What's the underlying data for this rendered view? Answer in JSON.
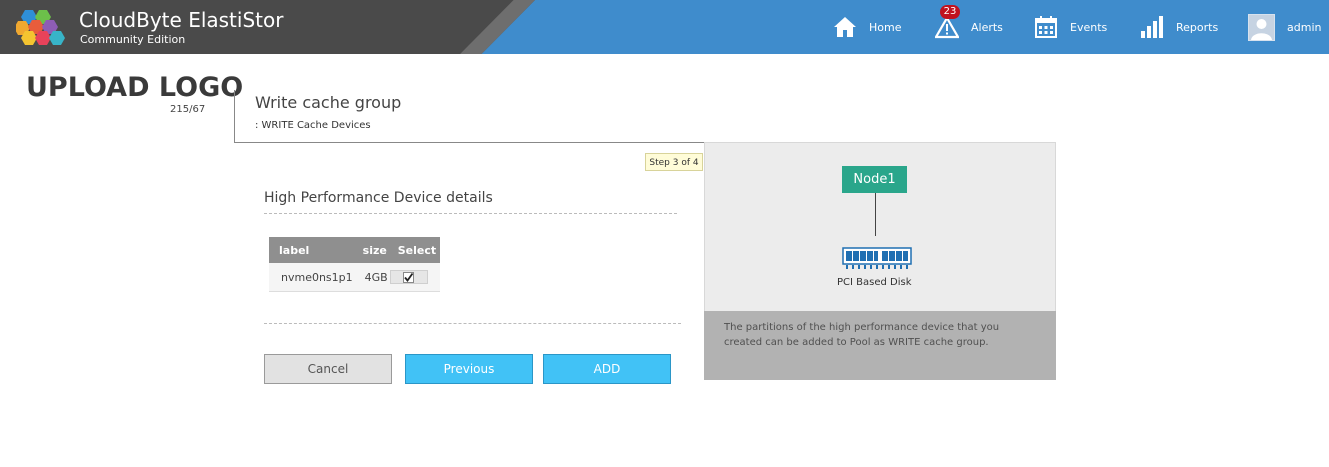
{
  "app": {
    "title": "CloudByte ElastiStor",
    "edition": "Community Edition"
  },
  "nav": {
    "home": "Home",
    "alerts": "Alerts",
    "alerts_count": "23",
    "events": "Events",
    "reports": "Reports",
    "user": "admin"
  },
  "upload": {
    "label": "UPLOAD LOGO",
    "count": "215/67"
  },
  "step": {
    "title": "Write cache group",
    "subtitle": ": WRITE Cache Devices",
    "indicator": "Step 3 of 4"
  },
  "section": {
    "title": "High Performance Device details"
  },
  "table": {
    "headers": [
      "label",
      "size",
      "Select"
    ],
    "rows": [
      {
        "label": "nvme0ns1p1",
        "size": "4GB",
        "selected": true
      }
    ]
  },
  "buttons": {
    "cancel": "Cancel",
    "previous": "Previous",
    "add": "ADD"
  },
  "diagram": {
    "node": "Node1",
    "disk_label": "PCI Based Disk"
  },
  "info": {
    "text": "The partitions of the high performance device that you created can be added to Pool as WRITE cache group."
  },
  "colors": {
    "topbar_blue": "#3f8ccc",
    "brand_dark": "#4a4a4a",
    "accent_blue": "#41c2f6",
    "node_green": "#2aa68b",
    "alert_red": "#c0121f"
  },
  "icons": {
    "home": "home-icon",
    "alerts": "warning-icon",
    "events": "calendar-icon",
    "reports": "bar-chart-icon",
    "user": "avatar-icon"
  }
}
